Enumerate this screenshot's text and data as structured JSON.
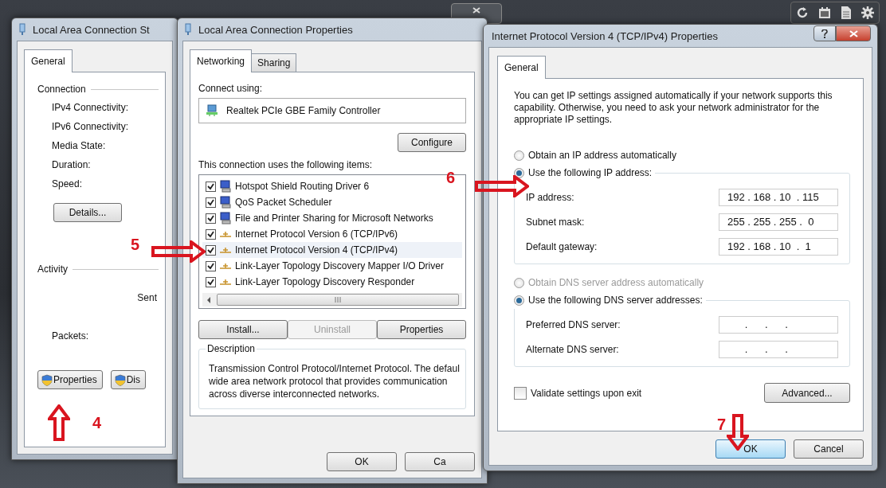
{
  "status_window": {
    "title": "Local Area Connection St",
    "tabs": [
      {
        "label": "General",
        "selected": true
      }
    ],
    "connection": {
      "heading": "Connection",
      "rows": [
        "IPv4 Connectivity:",
        "IPv6 Connectivity:",
        "Media State:",
        "Duration:",
        "Speed:"
      ],
      "details_button": "Details..."
    },
    "activity": {
      "heading": "Activity",
      "sent": "Sent",
      "packets": "Packets:"
    },
    "buttons": [
      "Properties",
      "Dis"
    ]
  },
  "properties_window": {
    "title": "Local Area Connection Properties",
    "tabs": [
      {
        "label": "Networking",
        "selected": true
      },
      {
        "label": "Sharing",
        "selected": false
      }
    ],
    "connect_using": "Connect using:",
    "adapter": "Realtek PCIe GBE Family Controller",
    "configure_button": "Configure",
    "items_label": "This connection uses the following items:",
    "items": [
      {
        "label": "Hotspot Shield Routing Driver 6",
        "kind": "client",
        "checked": true,
        "selected": false
      },
      {
        "label": "QoS Packet Scheduler",
        "kind": "client",
        "checked": true,
        "selected": false
      },
      {
        "label": "File and Printer Sharing for Microsoft Networks",
        "kind": "client",
        "checked": true,
        "selected": false
      },
      {
        "label": "Internet Protocol Version 6 (TCP/IPv6)",
        "kind": "protocol",
        "checked": true,
        "selected": false
      },
      {
        "label": "Internet Protocol Version 4 (TCP/IPv4)",
        "kind": "protocol",
        "checked": true,
        "selected": true
      },
      {
        "label": "Link-Layer Topology Discovery Mapper I/O Driver",
        "kind": "protocol",
        "checked": true,
        "selected": false
      },
      {
        "label": "Link-Layer Topology Discovery Responder",
        "kind": "protocol",
        "checked": true,
        "selected": false
      }
    ],
    "item_buttons": [
      {
        "label": "Install...",
        "disabled": false
      },
      {
        "label": "Uninstall",
        "disabled": true
      },
      {
        "label": "Properties",
        "disabled": false
      }
    ],
    "description": {
      "heading": "Description",
      "lines": [
        "Transmission Control Protocol/Internet Protocol. The defaul",
        "wide area network protocol that provides communication",
        "across diverse interconnected networks."
      ]
    },
    "buttons": [
      "OK",
      "Ca"
    ]
  },
  "ipv4_window": {
    "title": "Internet Protocol Version 4 (TCP/IPv4) Properties",
    "tabs": [
      {
        "label": "General",
        "selected": true
      }
    ],
    "intro": "You can get IP settings assigned automatically if your network supports this capability. Otherwise, you need to ask your network administrator for the appropriate IP settings.",
    "ip_options": [
      {
        "label": "Obtain an IP address automatically",
        "selected": false,
        "disabled": false
      },
      {
        "label": "Use the following IP address:",
        "selected": true,
        "disabled": false
      }
    ],
    "ip_fields": [
      {
        "label": "IP address:",
        "value": "192 . 168 . 10  . 115"
      },
      {
        "label": "Subnet mask:",
        "value": "255 . 255 . 255 .  0"
      },
      {
        "label": "Default gateway:",
        "value": "192 . 168 . 10  .  1"
      }
    ],
    "dns_options": [
      {
        "label": "Obtain DNS server address automatically",
        "selected": false,
        "disabled": true
      },
      {
        "label": "Use the following DNS server addresses:",
        "selected": true,
        "disabled": false
      }
    ],
    "dns_fields": [
      {
        "label": "Preferred DNS server:",
        "value": "      .      .      ."
      },
      {
        "label": "Alternate DNS server:",
        "value": "      .      .      ."
      }
    ],
    "validate": {
      "label": "Validate settings upon exit",
      "checked": false
    },
    "advanced_button": "Advanced...",
    "buttons": [
      {
        "label": "OK",
        "default": true
      },
      {
        "label": "Cancel",
        "default": false
      }
    ]
  },
  "annotations": [
    {
      "number": "4",
      "kind": "up"
    },
    {
      "number": "5",
      "kind": "right"
    },
    {
      "number": "6",
      "kind": "right"
    },
    {
      "number": "7",
      "kind": "down"
    }
  ]
}
